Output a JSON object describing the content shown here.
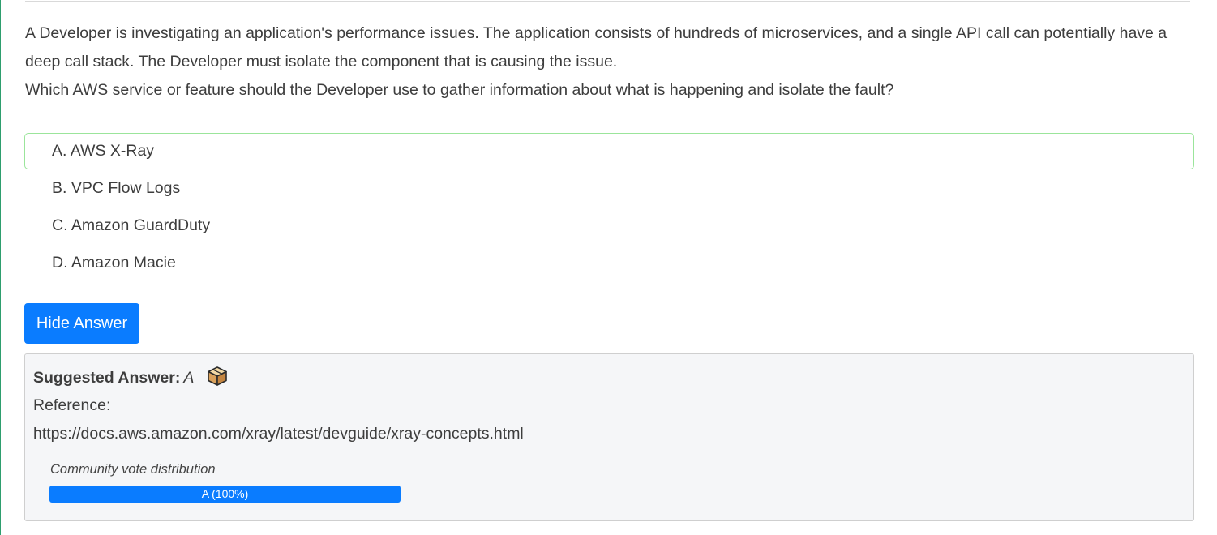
{
  "question": {
    "text_1": "A Developer is investigating an application's performance issues. The application consists of hundreds of microservices, and a single API call can potentially have a deep call stack. The Developer must isolate the component that is causing the issue.",
    "text_2": "Which AWS service or feature should the Developer use to gather information about what is happening and isolate the fault?"
  },
  "choices": [
    {
      "label": "A. AWS X-Ray",
      "highlighted": true
    },
    {
      "label": "B. VPC Flow Logs",
      "highlighted": false
    },
    {
      "label": "C. Amazon GuardDuty",
      "highlighted": false
    },
    {
      "label": "D. Amazon Macie",
      "highlighted": false
    }
  ],
  "hide_answer_button": "Hide Answer",
  "answer": {
    "suggested_label": "Suggested Answer:",
    "suggested_value": "A",
    "icon": "package-icon",
    "reference_label": "Reference:",
    "reference_url": "https://docs.aws.amazon.com/xray/latest/devguide/xray-concepts.html"
  },
  "votes": {
    "title": "Community vote distribution",
    "bar_label": "A (100%)",
    "percent": 100
  },
  "colors": {
    "accent": "#0a7cff",
    "correct_border": "#9be59b",
    "card_border": "#2e9e6e",
    "answer_bg": "#f5f6f8"
  }
}
